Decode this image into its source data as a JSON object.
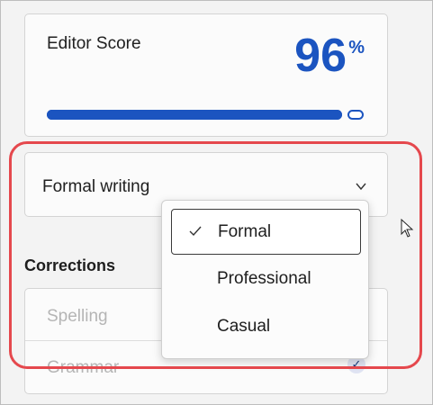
{
  "editor_score": {
    "label": "Editor Score",
    "value": "96",
    "unit": "%",
    "progress_fraction": 0.96
  },
  "style_dropdown": {
    "selected_label": "Formal writing",
    "options": [
      {
        "label": "Formal",
        "checked": true
      },
      {
        "label": "Professional",
        "checked": false
      },
      {
        "label": "Casual",
        "checked": false
      }
    ]
  },
  "corrections": {
    "title": "Corrections",
    "items": [
      {
        "label": "Spelling"
      },
      {
        "label": "Grammar"
      }
    ]
  },
  "colors": {
    "accent": "#1b54c0",
    "highlight": "#e5484d"
  },
  "icons": {
    "dropdown": "chevron-down-icon",
    "selected": "checkmark-icon",
    "pointer": "mouse-cursor-icon"
  }
}
